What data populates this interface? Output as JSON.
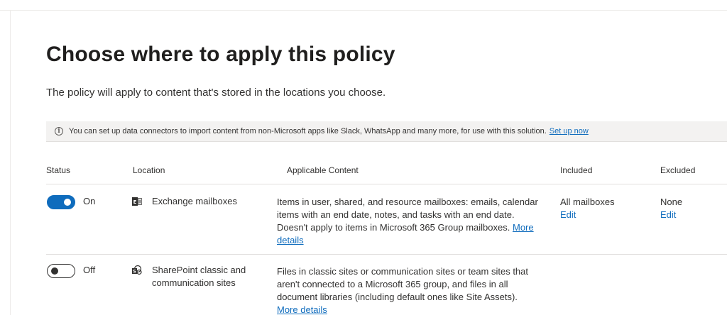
{
  "page": {
    "title": "Choose where to apply this policy",
    "subtitle": "The policy will apply to content that's stored in the locations you choose."
  },
  "infobar": {
    "text": "You can set up data connectors to import content from non-Microsoft apps like Slack, WhatsApp and many more, for use with this solution.",
    "link": "Set up now",
    "icon": "info-icon"
  },
  "table": {
    "headers": {
      "status": "Status",
      "location": "Location",
      "content": "Applicable Content",
      "included": "Included",
      "excluded": "Excluded"
    },
    "rows": [
      {
        "status": "On",
        "location": "Exchange mailboxes",
        "location_icon": "exchange-icon",
        "content": "Items in user, shared, and resource mailboxes: emails, calendar items with an end date, notes, and tasks with an end date. Doesn't apply to items in Microsoft 365 Group mailboxes.",
        "content_link": "More details",
        "included": "All mailboxes",
        "included_edit": "Edit",
        "excluded": "None",
        "excluded_edit": "Edit"
      },
      {
        "status": "Off",
        "location": "SharePoint classic and communication sites",
        "location_icon": "sharepoint-icon",
        "content": "Files in classic sites or communication sites or team sites that aren't connected to a Microsoft 365 group, and files in all document libraries (including default ones like Site Assets).",
        "content_link": "More details"
      }
    ]
  },
  "colors": {
    "accent": "#0f6cbd",
    "text": "#323130",
    "infobar_bg": "#f3f2f1"
  }
}
